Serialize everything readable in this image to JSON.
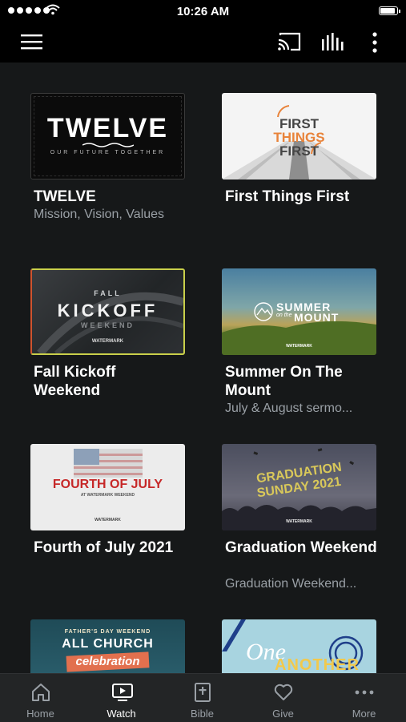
{
  "status": {
    "time": "10:26 AM"
  },
  "toolbar": {
    "menu_icon": "hamburger-menu-icon",
    "cast_icon": "cast-icon",
    "audio_icon": "audio-bars-icon",
    "more_icon": "more-vertical-icon"
  },
  "series": [
    {
      "title": "TWELVE",
      "subtitle": "Mission, Vision, Values",
      "art_title": "TWELVE",
      "art_tagline": "OUR FUTURE TOGETHER"
    },
    {
      "title": "First Things First",
      "subtitle": "",
      "art_lines": [
        "FIRST",
        "THINGS",
        "FIRST"
      ]
    },
    {
      "title": "Fall Kickoff Weekend",
      "subtitle": "",
      "art_top": "FALL",
      "art_main": "KICKOFF",
      "art_bottom": "WEEKEND",
      "art_brand": "WATERMARK"
    },
    {
      "title": "Summer On The Mount",
      "subtitle": "July & August sermo...",
      "art_main": "SUMMER",
      "art_script": "on the",
      "art_bottom": "MOUNT",
      "art_brand": "WATERMARK"
    },
    {
      "title": "Fourth of July 2021",
      "subtitle": "",
      "art_main": "FOURTH OF JULY",
      "art_sub": "AT WATERMARK WEEKEND",
      "art_brand": "WATERMARK"
    },
    {
      "title": "Graduation Weekend",
      "subtitle": "Graduation Weekend...",
      "art_main": "GRADUATION",
      "art_sub": "SUNDAY 2021",
      "art_brand": "WATERMARK"
    },
    {
      "title": "",
      "subtitle": "",
      "art_top": "FATHER'S DAY WEEKEND",
      "art_main": "ALL CHURCH",
      "art_script": "celebration"
    },
    {
      "title": "",
      "subtitle": "",
      "art_main": "One",
      "art_sub": "ANOTHER"
    }
  ],
  "tabs": [
    {
      "label": "Home",
      "icon": "home-icon"
    },
    {
      "label": "Watch",
      "icon": "tv-play-icon"
    },
    {
      "label": "Bible",
      "icon": "bible-icon"
    },
    {
      "label": "Give",
      "icon": "heart-icon"
    },
    {
      "label": "More",
      "icon": "more-horizontal-icon"
    }
  ],
  "active_tab": "Watch",
  "colors": {
    "background": "#161819",
    "tabbar": "#232526",
    "accent_orange": "#e8833a",
    "july_red": "#c62828"
  }
}
